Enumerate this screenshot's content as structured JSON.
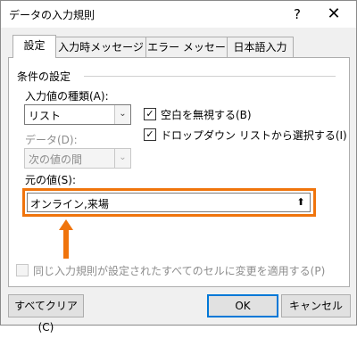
{
  "window": {
    "title": "データの入力規則",
    "help_glyph": "?",
    "close_glyph": "✕"
  },
  "tabs": [
    {
      "label": "設定"
    },
    {
      "label": "入力時メッセージ"
    },
    {
      "label": "エラー メッセージ"
    },
    {
      "label": "日本語入力"
    }
  ],
  "settings": {
    "section_label": "条件の設定",
    "allow_label": "入力値の種類(A):",
    "allow_value": "リスト",
    "data_label": "データ(D):",
    "data_value": "次の値の間",
    "ignore_blank_label": "空白を無視する(B)",
    "ignore_blank_checked": true,
    "dropdown_label": "ドロップダウン リストから選択する(I)",
    "dropdown_checked": true,
    "source_label": "元の値(S):",
    "source_value": "オンライン,来場",
    "apply_all_label": "同じ入力規則が設定されたすべてのセルに変更を適用する(P)",
    "apply_all_checked": false,
    "check_glyph": "✓",
    "combo_arrow_glyph": "⌄",
    "collapse_glyph": "⬆"
  },
  "buttons": {
    "clear_all": "すべてクリア(C)",
    "ok": "OK",
    "cancel": "キャンセル"
  },
  "colors": {
    "highlight": "#f0740c",
    "default_button": "#0078d7"
  }
}
